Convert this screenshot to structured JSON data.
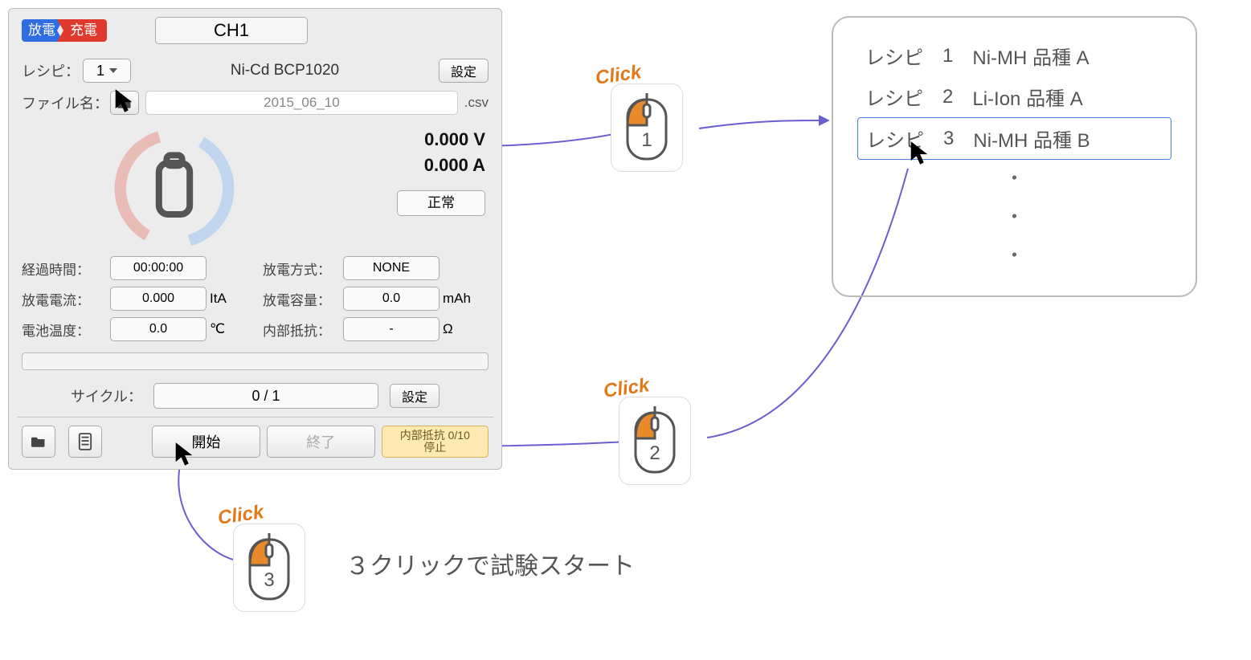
{
  "mode": {
    "discharge": "放電",
    "charge": "充電"
  },
  "channel": "CH1",
  "recipe": {
    "label": "レシピ：",
    "selected": "1",
    "name": "Ni-Cd BCP1020",
    "settings_btn": "設定"
  },
  "file": {
    "label": "ファイル名：",
    "name": "2015_06_10",
    "ext": ".csv"
  },
  "readings": {
    "voltage": "0.000 V",
    "current": "0.000 A",
    "status": "正常"
  },
  "metrics": {
    "elapsed_label": "経過時間：",
    "elapsed": "00:00:00",
    "discharge_mode_label": "放電方式：",
    "discharge_mode": "NONE",
    "discharge_current_label": "放電電流：",
    "discharge_current": "0.000",
    "discharge_current_unit": "ItA",
    "discharge_capacity_label": "放電容量：",
    "discharge_capacity": "0.0",
    "discharge_capacity_unit": "mAh",
    "temp_label": "電池温度：",
    "temp": "0.0",
    "temp_unit": "℃",
    "ir_label": "内部抵抗：",
    "ir": "-",
    "ir_unit": "Ω"
  },
  "cycle": {
    "label": "サイクル：",
    "value": "0 / 1",
    "settings_btn": "設定"
  },
  "bottom": {
    "start": "開始",
    "end": "終了",
    "ir_status_line1": "内部抵抗 0/10",
    "ir_status_line2": "停止"
  },
  "recipe_list": [
    {
      "label": "レシピ",
      "num": "1",
      "name": "Ni-MH 品種 A"
    },
    {
      "label": "レシピ",
      "num": "2",
      "name": "Li-Ion 品種 A"
    },
    {
      "label": "レシピ",
      "num": "3",
      "name": "Ni-MH 品種 B"
    }
  ],
  "click_label": "Click",
  "caption": "３クリックで試験スタート"
}
